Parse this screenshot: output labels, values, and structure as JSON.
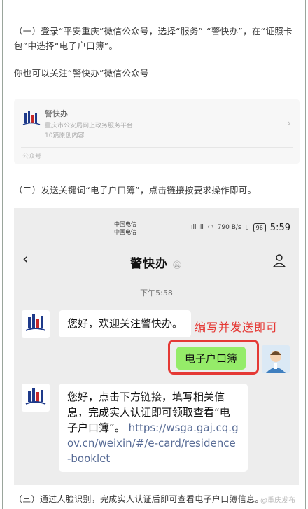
{
  "article": {
    "step1": "（一）登录“平安重庆”微信公众号，选择“服务”-“警快办”，在“证照卡包”中选择“电子户口簿”。",
    "alt": "你也可以关注“警快办”微信公众号",
    "step2": "（二）发送关键词“电子户口簿”，点击链接按要求操作即可。",
    "step3": "（三）通过人脸识别，完成实人认证后即可查看电子户口簿信息。"
  },
  "account_card": {
    "name": "警快办",
    "description": "重庆市公安局网上政务服务平台",
    "article_count": "10篇原创内容",
    "type_label": "公众号",
    "logo_icon": "jingkuaiban-logo-icon"
  },
  "phone": {
    "carrier1": "中国电信",
    "carrier2": "中国电信",
    "net_speed": "790 B/s",
    "battery": "96",
    "time": "5:59",
    "chat_title": "警快办",
    "timestamp": "下午5:58",
    "msg_welcome": "您好，欢迎关注警快办。",
    "msg_sent": "电子户口簿",
    "msg_reply_text": "您好，点击下方链接，填写相关信息，完成实人认证即可领取查看“电子户口簿”。",
    "msg_reply_link": "https://wsga.gaj.cq.gov.cn/weixin/#/e-card/residence-booklet",
    "annotation": "编写并发送即可"
  },
  "watermark": "@重庆发布",
  "colors": {
    "link": "#576b95",
    "accent_red": "#e53935",
    "sent_bubble": "#95ec69"
  }
}
